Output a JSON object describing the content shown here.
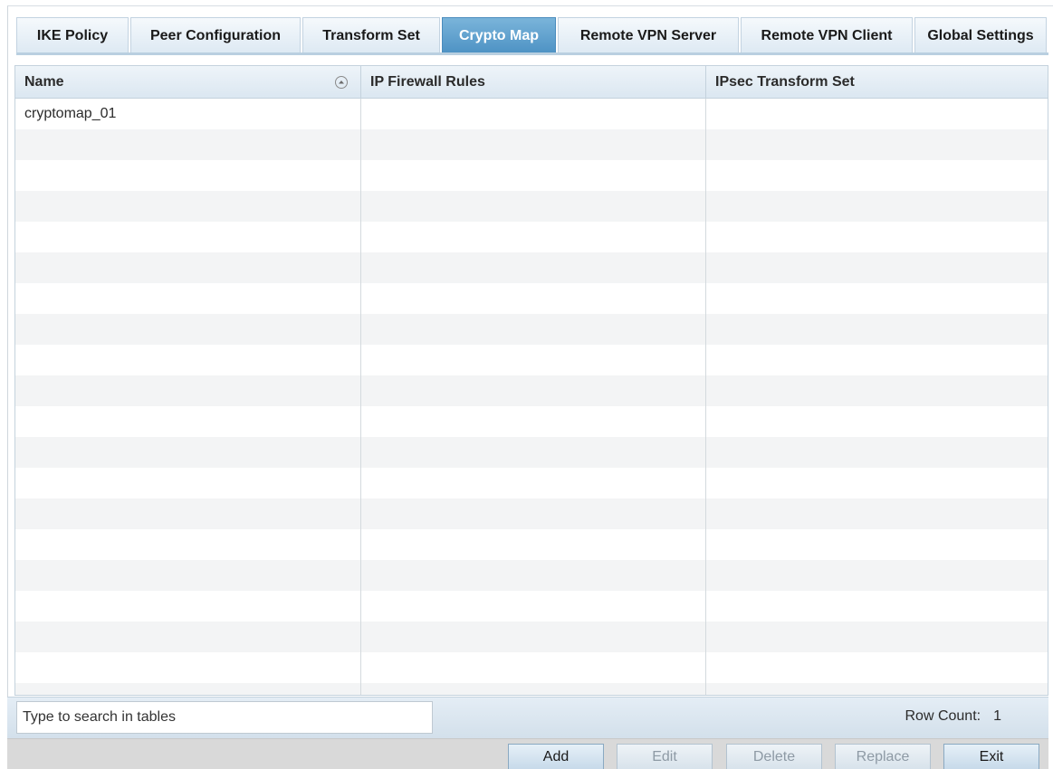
{
  "tabs": [
    {
      "label": "IKE Policy",
      "active": false
    },
    {
      "label": "Peer Configuration",
      "active": false
    },
    {
      "label": "Transform Set",
      "active": false
    },
    {
      "label": "Crypto Map",
      "active": true
    },
    {
      "label": "Remote VPN Server",
      "active": false
    },
    {
      "label": "Remote VPN Client",
      "active": false
    },
    {
      "label": "Global Settings",
      "active": false
    }
  ],
  "table": {
    "columns": [
      "Name",
      "IP Firewall Rules",
      "IPsec Transform Set"
    ],
    "sort_icon": "sort-circle-icon",
    "rows": [
      [
        "cryptomap_01",
        "",
        ""
      ]
    ]
  },
  "footer": {
    "search_placeholder": "Type to search in tables",
    "row_count_label": "Row Count:",
    "row_count_value": "1"
  },
  "buttons": {
    "add": "Add",
    "edit": "Edit",
    "delete": "Delete",
    "replace": "Replace",
    "exit": "Exit"
  },
  "colors": {
    "active_tab": "#5a9bcb",
    "header_bg": "#dbe7f1"
  }
}
